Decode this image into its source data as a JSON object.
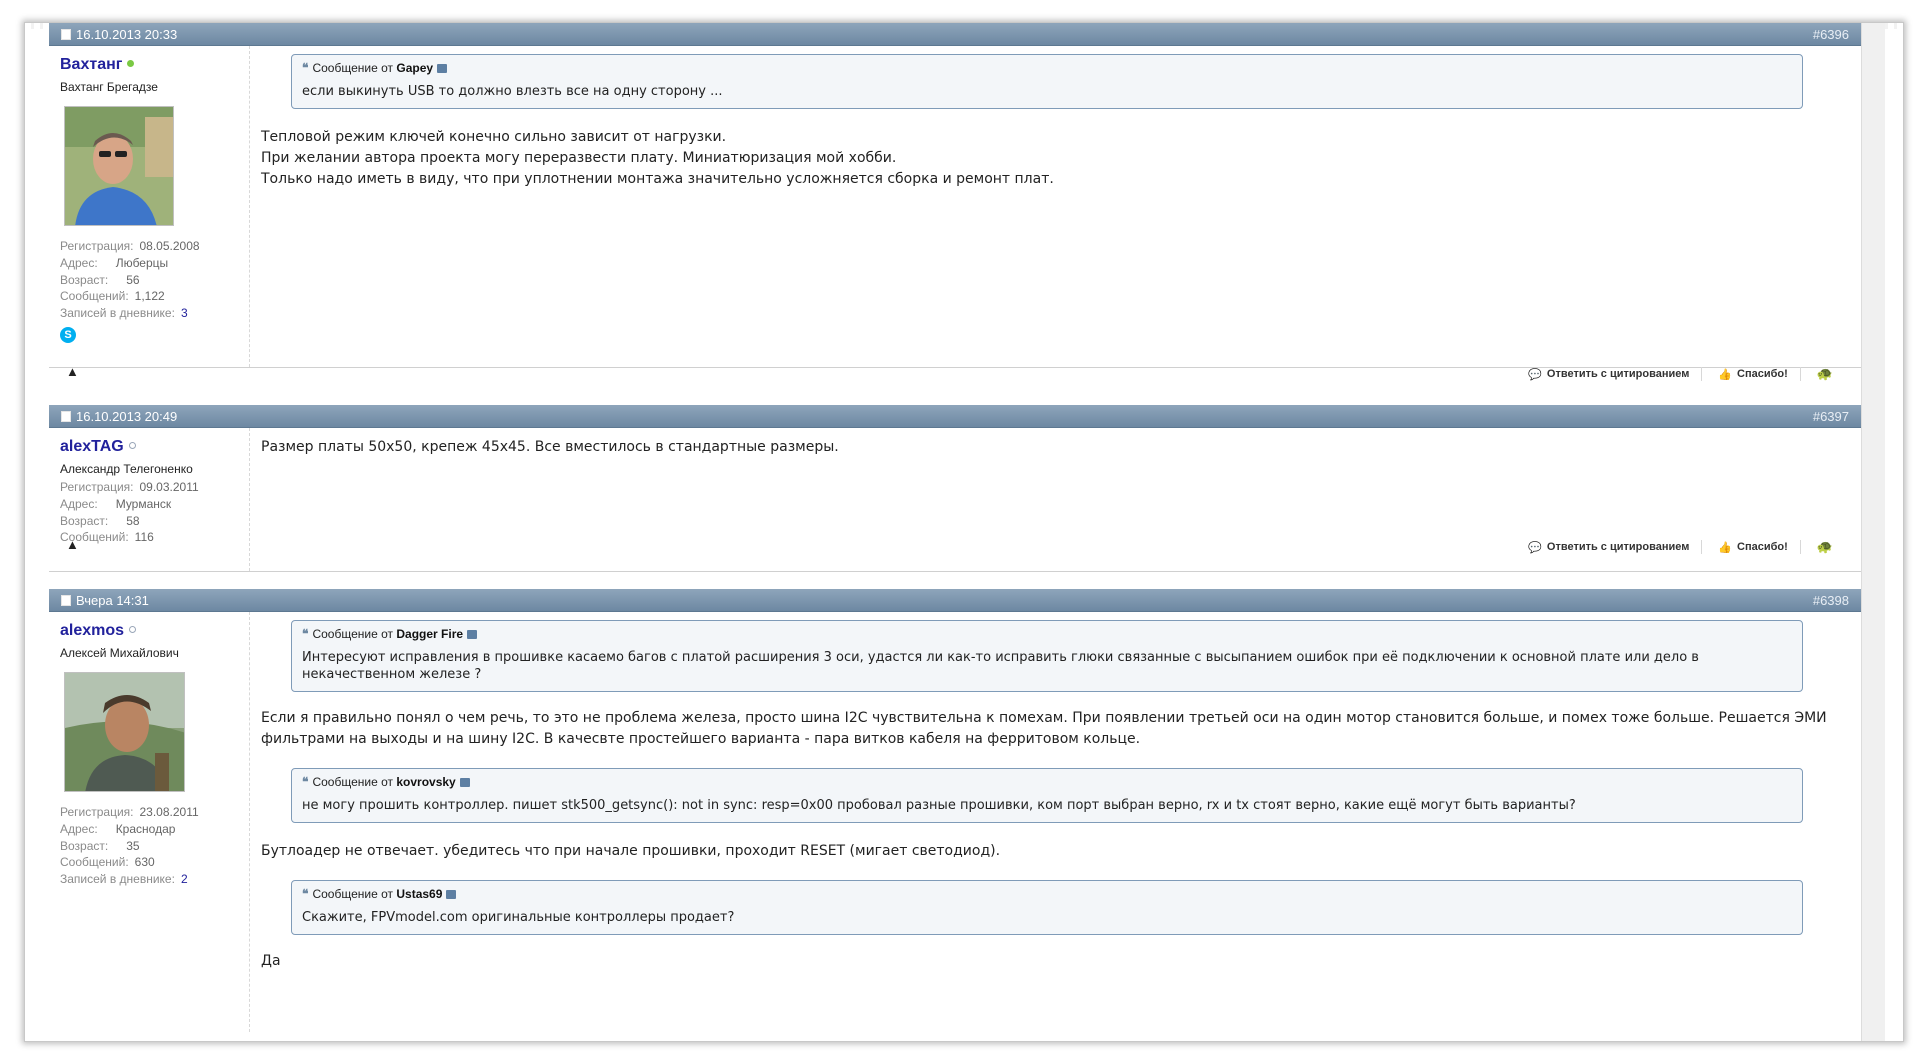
{
  "posts": [
    {
      "date": "16.10.2013 20:33",
      "num": "#6396",
      "username": "Вахтанг",
      "online": true,
      "realname": "Вахтанг Брегадзе",
      "info": [
        {
          "k": "Регистрация:",
          "v": "08.05.2008"
        },
        {
          "k": "Адрес:",
          "v": "Люберцы"
        },
        {
          "k": "Возраст:",
          "v": "56"
        },
        {
          "k": "Сообщений:",
          "v": "1,122"
        },
        {
          "k": "Записей в дневнике:",
          "v": "3"
        }
      ],
      "quote": {
        "prefix": "Сообщение от",
        "author": "Gapey",
        "text": "если выкинуть USB то должно влезть все на одну сторону ..."
      },
      "lines": [
        "Тепловой режим ключей конечно сильно зависит от нагрузки.",
        "При желании автора проекта могу переразвести плату. Миниатюризация мой хобби.",
        "Только надо иметь в виду, что при уплотнении монтажа значительно усложняется сборка и ремонт плат."
      ]
    },
    {
      "date": "16.10.2013 20:49",
      "num": "#6397",
      "username": "alexTAG",
      "online": false,
      "realname": "Александр Телегоненко",
      "info": [
        {
          "k": "Регистрация:",
          "v": "09.03.2011"
        },
        {
          "k": "Адрес:",
          "v": "Мурманск"
        },
        {
          "k": "Возраст:",
          "v": "58"
        },
        {
          "k": "Сообщений:",
          "v": "116"
        }
      ],
      "text": "Размер платы 50х50, крепеж 45х45. Все вместилось в стандартные размеры."
    },
    {
      "date": "Вчера 14:31",
      "num": "#6398",
      "username": "alexmos",
      "online": false,
      "realname": "Алексей Михайлович",
      "info": [
        {
          "k": "Регистрация:",
          "v": "23.08.2011"
        },
        {
          "k": "Адрес:",
          "v": "Краснодар"
        },
        {
          "k": "Возраст:",
          "v": "35"
        },
        {
          "k": "Сообщений:",
          "v": "630"
        },
        {
          "k": "Записей в дневнике:",
          "v": "2"
        }
      ],
      "quote1": {
        "prefix": "Сообщение от",
        "author": "Dagger Fire",
        "text": "Интересуют исправления в прошивке касаемо багов с платой расширения 3 оси, удастся ли как-то исправить глюки связанные с высыпанием ошибок при её подключении к основной плате или дело в некачественном железе ?"
      },
      "text1": "Если я правильно понял о чем речь, то это не проблема железа, просто шина I2C чувствительна к помехам. При появлении третьей оси на один мотор становится больше, и помех тоже больше. Решается ЭМИ фильтрами на выходы и на шину I2C. В качесвте простейшего варианта - пара витков кабеля на ферритовом кольце.",
      "quote2": {
        "prefix": "Сообщение от",
        "author": "kovrovsky",
        "text": "не могу прошить контроллер. пишет stk500_getsync(): not in sync: resp=0x00 пробовал разные прошивки, ком порт выбран верно, rx и tx стоят верно, какие ещё могут быть варианты?"
      },
      "text2": "Бутлоадер не отвечает. убедитесь что при начале прошивки, проходит RESET (мигает светодиод).",
      "quote3": {
        "prefix": "Сообщение от",
        "author": "Ustas69",
        "text": "Скажите, FPVmodel.com оригинальные контроллеры продает?"
      },
      "text3": "Да"
    }
  ],
  "actions": {
    "reply": "Ответить с цитированием",
    "thanks": "Спасибо!"
  },
  "icons": {
    "report": "warning-triangle-icon",
    "reply": "quote-bubble-icon",
    "thanks": "thumbs-up-icon",
    "turtle": "turtle-icon",
    "skype": "skype-icon"
  },
  "colors": {
    "header_bar": "#7a93ab",
    "username": "#22229c",
    "quote_border": "#7f9bb8",
    "online": "#7ac943"
  }
}
